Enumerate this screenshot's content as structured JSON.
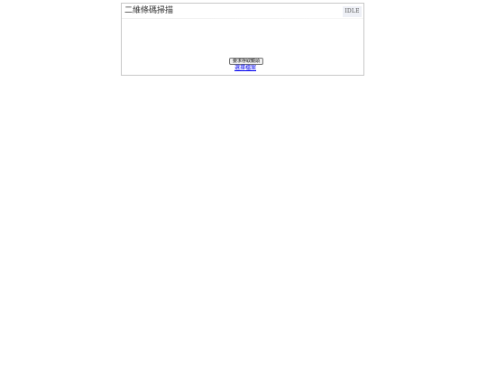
{
  "panel": {
    "title": "二維條碼掃描",
    "status": "IDLE"
  },
  "actions": {
    "button_label": "要求存取鏡頭",
    "link_label": "選擇檔案"
  }
}
